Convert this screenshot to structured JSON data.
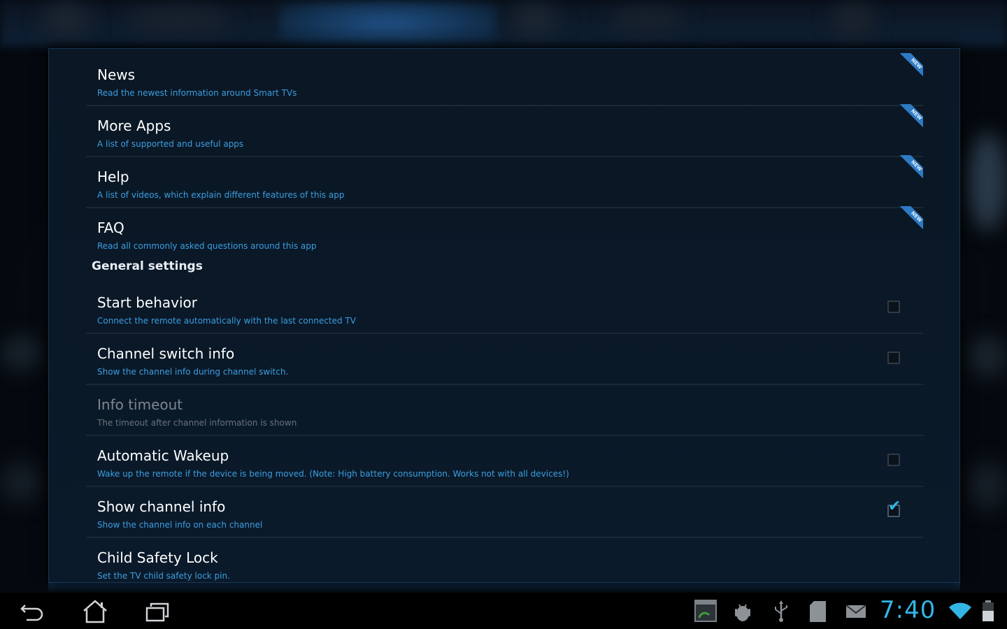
{
  "settings": {
    "top_items": [
      {
        "title": "News",
        "summary": "Read the newest information around Smart TVs",
        "badge": "NEW"
      },
      {
        "title": "More Apps",
        "summary": "A list of supported and useful apps",
        "badge": "NEW"
      },
      {
        "title": "Help",
        "summary": "A list of videos, which explain different features of this app",
        "badge": "NEW"
      },
      {
        "title": "FAQ",
        "summary": "Read all commonly asked questions around this app",
        "badge": "NEW"
      }
    ],
    "category": "General settings",
    "general_items": [
      {
        "title": "Start behavior",
        "summary": "Connect the remote automatically with the last connected TV",
        "checked": false
      },
      {
        "title": "Channel switch info",
        "summary": "Show the channel info during channel switch.",
        "checked": false
      },
      {
        "title": "Info timeout",
        "summary": "The timeout after channel information is shown",
        "enabled": false
      },
      {
        "title": "Automatic Wakeup",
        "summary": "Wake up the remote if the device is being moved. (Note: High battery consumption. Works not with all devices!)",
        "checked": false
      },
      {
        "title": "Show channel info",
        "summary": "Show the channel info on each channel",
        "checked": true
      },
      {
        "title": "Child Safety Lock",
        "summary": "Set the TV child safety lock pin."
      }
    ]
  },
  "system_bar": {
    "clock": "7:40",
    "nav_icons": [
      "back-icon",
      "home-icon",
      "recent-apps-icon"
    ],
    "status_icons": [
      "screenshot-icon",
      "android-debug-icon",
      "usb-icon",
      "sd-card-icon",
      "email-icon",
      "wifi-icon",
      "battery-icon"
    ],
    "accent_color": "#33b5e5"
  }
}
